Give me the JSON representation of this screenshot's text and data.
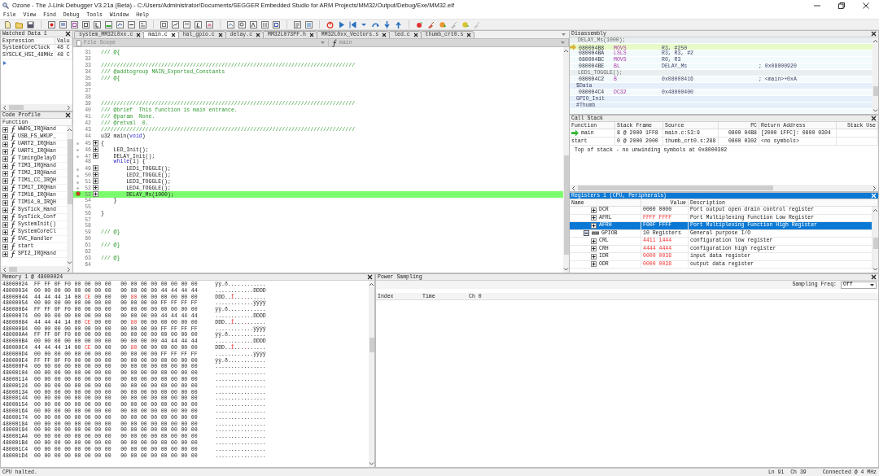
{
  "window": {
    "title": "Ozone - The J-Link Debugger V3.21a (Beta) - C:/Users/Administrator/Documents/SEGGER Embedded Studio for ARM Projects/MM32/Output/Debug/Exe/MM32.elf"
  },
  "menu": [
    "File",
    "View",
    "Find",
    "Debug",
    "Tools",
    "Window",
    "Help"
  ],
  "watched_data": {
    "title": "Watched Data 1",
    "columns": [
      "Expression",
      "Valu"
    ],
    "rows": [
      {
        "expression": "SystemCoreClock",
        "value": "48 C"
      },
      {
        "expression": "SYSCLK_HSI_48MHz",
        "value": "48 C"
      }
    ]
  },
  "code_profile": {
    "title": "Code Profile",
    "columns": [
      "Function"
    ],
    "rows": [
      "WWDG_IRQHand",
      "USB_FS_WKUP_",
      "UART2_IRQHan",
      "UART1_IRQHan",
      "TimingDelayD",
      "TIM3_IRQHand",
      "TIM2_IRQHand",
      "TIM1_CC_IRQH",
      "TIM17_IRQHan",
      "TIM16_IRQHan",
      "TIM14_0_IRQH",
      "SysTick_Hand",
      "SysTick_Conf",
      "SystemInit()",
      "SystemCoreCl",
      "SVC_Handler",
      "start",
      "SPI2_IRQHand"
    ]
  },
  "editor": {
    "tabs": [
      {
        "label": "system_MM32L0xx.c",
        "selected": false
      },
      {
        "label": "main.c",
        "selected": true
      },
      {
        "label": "hal_gpio.c",
        "selected": false
      },
      {
        "label": "delay.c",
        "selected": false
      },
      {
        "label": "MM32L073PF.h",
        "selected": false
      },
      {
        "label": "MM32L0xx_Vectors.s",
        "selected": false
      },
      {
        "label": "led.c",
        "selected": false
      },
      {
        "label": "thumb_crt0.s",
        "selected": false
      }
    ],
    "scope": "File Scope",
    "function": "main",
    "lines": [
      {
        "number": "31",
        "parts": [
          {
            "text": "/// @{",
            "kind": "comment"
          }
        ],
        "breakable": false,
        "breakpoint": false,
        "current": false
      },
      {
        "number": "32",
        "breakable": false,
        "breakpoint": false,
        "current": false
      },
      {
        "number": "33",
        "parts": [
          {
            "text": "////////////////////////////////////////////////////////////////////////////////",
            "kind": "comment"
          }
        ],
        "breakable": false,
        "breakpoint": false,
        "current": false
      },
      {
        "number": "34",
        "parts": [
          {
            "text": "/// @addtogroup MAIN_Exported_Constants",
            "kind": "comment"
          }
        ],
        "breakable": false,
        "breakpoint": false,
        "current": false
      },
      {
        "number": "35",
        "parts": [
          {
            "text": "/// @{",
            "kind": "comment"
          }
        ],
        "breakable": false,
        "breakpoint": false,
        "current": false
      },
      {
        "number": "36",
        "breakable": false,
        "breakpoint": false,
        "current": false
      },
      {
        "number": "37",
        "breakable": false,
        "breakpoint": false,
        "current": false
      },
      {
        "number": "38",
        "breakable": false,
        "breakpoint": false,
        "current": false
      },
      {
        "number": "39",
        "parts": [
          {
            "text": "////////////////////////////////////////////////////////////////////////////////",
            "kind": "comment"
          }
        ],
        "breakable": false,
        "breakpoint": false,
        "current": false
      },
      {
        "number": "40",
        "parts": [
          {
            "text": "/// @brief  This function is main entrance.",
            "kind": "comment"
          }
        ],
        "breakable": false,
        "breakpoint": false,
        "current": false
      },
      {
        "number": "41",
        "parts": [
          {
            "text": "/// @param  None.",
            "kind": "comment"
          }
        ],
        "breakable": false,
        "breakpoint": false,
        "current": false
      },
      {
        "number": "42",
        "parts": [
          {
            "text": "/// @retval  0.",
            "kind": "comment"
          }
        ],
        "breakable": false,
        "breakpoint": false,
        "current": false
      },
      {
        "number": "43",
        "parts": [
          {
            "text": "////////////////////////////////////////////////////////////////////////////////",
            "kind": "comment"
          }
        ],
        "breakable": false,
        "breakpoint": false,
        "current": false
      },
      {
        "number": "44",
        "parts": [
          {
            "text": "u32 main(",
            "kind": "code"
          },
          {
            "text": "void",
            "kind": "keyword"
          },
          {
            "text": ")",
            "kind": "code"
          }
        ],
        "breakable": false,
        "breakpoint": false,
        "current": false
      },
      {
        "number": "45",
        "parts": [
          {
            "text": "{",
            "kind": "code"
          }
        ],
        "breakable": true,
        "breakpoint": false,
        "current": false
      },
      {
        "number": "46",
        "parts": [
          {
            "text": "    LED_Init();",
            "kind": "code"
          }
        ],
        "breakable": true,
        "breakpoint": false,
        "current": false
      },
      {
        "number": "47",
        "parts": [
          {
            "text": "    DELAY_Init();",
            "kind": "code"
          }
        ],
        "breakable": true,
        "breakpoint": false,
        "current": false
      },
      {
        "number": "48",
        "parts": [
          {
            "text": "    while",
            "kind": "keyword"
          },
          {
            "text": "(1) {",
            "kind": "code"
          }
        ],
        "breakable": false,
        "breakpoint": false,
        "current": false
      },
      {
        "number": "49",
        "parts": [
          {
            "text": "        LED1_TOGGLE();",
            "kind": "code"
          }
        ],
        "breakable": true,
        "breakpoint": false,
        "current": false
      },
      {
        "number": "50",
        "parts": [
          {
            "text": "        LED2_TOGGLE();",
            "kind": "code"
          }
        ],
        "breakable": true,
        "breakpoint": false,
        "current": false
      },
      {
        "number": "51",
        "parts": [
          {
            "text": "        LED3_TOGGLE();",
            "kind": "code"
          }
        ],
        "breakable": true,
        "breakpoint": false,
        "current": false
      },
      {
        "number": "52",
        "parts": [
          {
            "text": "        LED4_TOGGLE();",
            "kind": "code"
          }
        ],
        "breakable": true,
        "breakpoint": false,
        "current": false
      },
      {
        "number": "53",
        "parts": [
          {
            "text": "        DELAY_Ms(1000);",
            "kind": "code"
          }
        ],
        "breakable": true,
        "breakpoint": true,
        "current": true
      },
      {
        "number": "54",
        "parts": [
          {
            "text": "    }",
            "kind": "code"
          }
        ],
        "breakable": false,
        "breakpoint": false,
        "current": false
      },
      {
        "number": "55",
        "breakable": false,
        "breakpoint": false,
        "current": false
      },
      {
        "number": "56",
        "parts": [
          {
            "text": "}",
            "kind": "code"
          }
        ],
        "breakable": false,
        "breakpoint": false,
        "current": false
      },
      {
        "number": "57",
        "breakable": false,
        "breakpoint": false,
        "current": false
      },
      {
        "number": "58",
        "breakable": false,
        "breakpoint": false,
        "current": false
      },
      {
        "number": "59",
        "parts": [
          {
            "text": "/// @}",
            "kind": "comment"
          }
        ],
        "breakable": false,
        "breakpoint": false,
        "current": false
      },
      {
        "number": "60",
        "breakable": false,
        "breakpoint": false,
        "current": false
      },
      {
        "number": "61",
        "parts": [
          {
            "text": "/// @}",
            "kind": "comment"
          }
        ],
        "breakable": false,
        "breakpoint": false,
        "current": false
      },
      {
        "number": "62",
        "breakable": false,
        "breakpoint": false,
        "current": false
      },
      {
        "number": "63",
        "parts": [
          {
            "text": "/// @}",
            "kind": "comment"
          }
        ],
        "breakable": false,
        "breakpoint": false,
        "current": false
      },
      {
        "number": "64",
        "breakable": false,
        "breakpoint": false,
        "current": false
      }
    ]
  },
  "disassembly": {
    "title": "Disassembly",
    "rows": [
      {
        "kind": "source",
        "text": "DELAY_Ms(1000);",
        "current": false
      },
      {
        "kind": "instruction",
        "address": "080004B8",
        "mnemonic": "MOVS",
        "operands": "R3, #250",
        "current": true
      },
      {
        "kind": "instruction",
        "address": "080004BA",
        "mnemonic": "LSLS",
        "operands": "R3, R3, #2",
        "current": false
      },
      {
        "kind": "instruction",
        "address": "080004BC",
        "mnemonic": "MOVS",
        "operands": "R0, R3",
        "current": false
      },
      {
        "kind": "instruction",
        "address": "080004BE",
        "mnemonic": "BL",
        "operands": "DELAY_Ms",
        "comment": "; 0x08000920",
        "current": false
      },
      {
        "kind": "source",
        "text": "LED1_TOGGLE();",
        "current": false
      },
      {
        "kind": "instruction",
        "address": "080004C2",
        "mnemonic": "B",
        "operands": "0x08000416",
        "comment": "; <main>+0xA",
        "current": false
      },
      {
        "kind": "label",
        "text": "$Data",
        "current": false
      },
      {
        "kind": "instruction",
        "address": "080004C4",
        "mnemonic": "DC32",
        "operands": "0x48000400",
        "current": false
      },
      {
        "kind": "label",
        "text": "GPIO_Init",
        "current": false
      },
      {
        "kind": "label",
        "text": "#Thumb",
        "current": false
      }
    ]
  },
  "call_stack": {
    "title": "Call Stack",
    "columns": [
      "Function",
      "Stack Frame",
      "Source",
      "PC",
      "Return Address",
      "Stack Use"
    ],
    "rows": [
      {
        "function": "main",
        "frame": "8 @ 2000 1FF8",
        "source": "main.c:53:9",
        "pc": "0800 04B8",
        "return_address": "[2000 1FFC]: 0800 0304",
        "current": true
      },
      {
        "function": "start",
        "frame": "0 @ 2000 2000",
        "source": "thumb_crt0.s:288",
        "pc": "0800 0302",
        "return_address": "<no symbols>",
        "current": false
      }
    ],
    "note": "Top of stack - no unwinding symbols at 0x8000302"
  },
  "registers": {
    "title": "Registers 1 (CPU, Peripherals)",
    "active": true,
    "columns": [
      "Name",
      "Value",
      "Description"
    ],
    "rows": [
      {
        "kind": "register",
        "name": "DCR",
        "value": "0000 0000",
        "description": "Port output open drain control register",
        "changed": false,
        "selected": false,
        "expanded": false
      },
      {
        "kind": "register",
        "name": "AFRL",
        "value": "FFFF FFFF",
        "description": "Port Multiplexing Function Low Register",
        "changed": true,
        "selected": false,
        "expanded": false
      },
      {
        "kind": "register",
        "name": "AFRH",
        "value": "F00F FFFF",
        "description": "Port Multiplexing Function High Register",
        "changed": false,
        "selected": true,
        "expanded": false
      },
      {
        "kind": "group",
        "name": "GPIOB",
        "value": "10 Registers",
        "description": "General purpose I/O",
        "changed": false,
        "selected": false,
        "expanded": true,
        "children": [
          {
            "kind": "register",
            "name": "CRL",
            "value": "4411 1444",
            "description": "configuration low register",
            "changed": true,
            "selected": false,
            "expanded": false
          },
          {
            "kind": "register",
            "name": "CRH",
            "value": "4444 4444",
            "description": "configuration high register",
            "changed": true,
            "selected": false,
            "expanded": false
          },
          {
            "kind": "register",
            "name": "IDR",
            "value": "0000 0038",
            "description": "input data register",
            "changed": true,
            "selected": false,
            "expanded": false
          },
          {
            "kind": "register",
            "name": "ODR",
            "value": "0000 0038",
            "description": "output data register",
            "changed": true,
            "selected": false,
            "expanded": false
          }
        ]
      }
    ]
  },
  "memory": {
    "title": "Memory 1 @ 48000024",
    "rows": [
      {
        "address": "48000024",
        "bytes": [
          "FF",
          "FF",
          "0F",
          "F0",
          "00",
          "00",
          "00",
          "00",
          "00",
          "00",
          "00",
          "00",
          "00",
          "00",
          "00",
          "00"
        ],
        "changed": [
          false,
          false,
          false,
          false,
          false,
          false,
          false,
          false,
          false,
          false,
          false,
          false,
          false,
          false,
          false,
          false
        ],
        "ascii": "ÿÿ.ð............"
      },
      {
        "address": "48000034",
        "bytes": [
          "00",
          "00",
          "00",
          "00",
          "00",
          "00",
          "00",
          "00",
          "00",
          "00",
          "00",
          "00",
          "44",
          "44",
          "44",
          "44"
        ],
        "changed": [
          false,
          false,
          false,
          false,
          false,
          false,
          false,
          false,
          false,
          false,
          false,
          false,
          false,
          false,
          false,
          false
        ],
        "ascii": "............DDDD"
      },
      {
        "address": "48000044",
        "bytes": [
          "44",
          "44",
          "44",
          "14",
          "00",
          "CE",
          "00",
          "00",
          "00",
          "80",
          "00",
          "00",
          "00",
          "00",
          "00",
          "00"
        ],
        "changed": [
          false,
          false,
          false,
          false,
          false,
          true,
          false,
          false,
          false,
          true,
          false,
          false,
          false,
          false,
          false,
          false
        ],
        "ascii": "DDD..Î.........."
      },
      {
        "address": "48000054",
        "bytes": [
          "00",
          "00",
          "00",
          "00",
          "00",
          "00",
          "00",
          "00",
          "00",
          "00",
          "00",
          "00",
          "FF",
          "FF",
          "FF",
          "FF"
        ],
        "changed": [
          false,
          false,
          false,
          false,
          false,
          false,
          false,
          false,
          false,
          false,
          false,
          false,
          false,
          false,
          false,
          false
        ],
        "ascii": "............ÿÿÿÿ"
      },
      {
        "address": "48000064",
        "bytes": [
          "FF",
          "FF",
          "0F",
          "F0",
          "00",
          "00",
          "00",
          "00",
          "00",
          "00",
          "00",
          "00",
          "00",
          "00",
          "00",
          "00"
        ],
        "changed": [
          false,
          false,
          false,
          false,
          false,
          false,
          false,
          false,
          false,
          false,
          false,
          false,
          false,
          false,
          false,
          false
        ],
        "ascii": "ÿÿ.ð............"
      },
      {
        "address": "48000074",
        "bytes": [
          "00",
          "00",
          "00",
          "00",
          "00",
          "00",
          "00",
          "00",
          "00",
          "00",
          "00",
          "00",
          "44",
          "44",
          "44",
          "44"
        ],
        "changed": [
          false,
          false,
          false,
          false,
          false,
          false,
          false,
          false,
          false,
          false,
          false,
          false,
          false,
          false,
          false,
          false
        ],
        "ascii": "............DDDD"
      },
      {
        "address": "48000084",
        "bytes": [
          "44",
          "44",
          "44",
          "14",
          "00",
          "CE",
          "00",
          "00",
          "00",
          "80",
          "00",
          "00",
          "00",
          "00",
          "00",
          "00"
        ],
        "changed": [
          false,
          false,
          false,
          false,
          false,
          true,
          false,
          false,
          false,
          true,
          false,
          false,
          false,
          false,
          false,
          false
        ],
        "ascii": "DDD..Î.........."
      },
      {
        "address": "48000094",
        "bytes": [
          "00",
          "00",
          "00",
          "00",
          "00",
          "00",
          "00",
          "00",
          "00",
          "00",
          "00",
          "00",
          "FF",
          "FF",
          "FF",
          "FF"
        ],
        "changed": [
          false,
          false,
          false,
          false,
          false,
          false,
          false,
          false,
          false,
          false,
          false,
          false,
          false,
          false,
          false,
          false
        ],
        "ascii": "............ÿÿÿÿ"
      },
      {
        "address": "480000A4",
        "bytes": [
          "FF",
          "FF",
          "0F",
          "F0",
          "00",
          "00",
          "00",
          "00",
          "00",
          "00",
          "00",
          "00",
          "00",
          "00",
          "00",
          "00"
        ],
        "changed": [
          false,
          false,
          false,
          false,
          false,
          false,
          false,
          false,
          false,
          false,
          false,
          false,
          false,
          false,
          false,
          false
        ],
        "ascii": "ÿÿ.ð............"
      },
      {
        "address": "480000B4",
        "bytes": [
          "00",
          "00",
          "00",
          "00",
          "00",
          "00",
          "00",
          "00",
          "00",
          "00",
          "00",
          "00",
          "44",
          "44",
          "44",
          "44"
        ],
        "changed": [
          false,
          false,
          false,
          false,
          false,
          false,
          false,
          false,
          false,
          false,
          false,
          false,
          false,
          false,
          false,
          false
        ],
        "ascii": "............DDDD"
      },
      {
        "address": "480000C4",
        "bytes": [
          "44",
          "44",
          "44",
          "14",
          "00",
          "CE",
          "00",
          "00",
          "00",
          "80",
          "00",
          "00",
          "00",
          "00",
          "00",
          "00"
        ],
        "changed": [
          false,
          false,
          false,
          false,
          false,
          true,
          false,
          false,
          false,
          true,
          false,
          false,
          false,
          false,
          false,
          false
        ],
        "ascii": "DDD..Î.........."
      },
      {
        "address": "480000D4",
        "bytes": [
          "00",
          "00",
          "00",
          "00",
          "00",
          "00",
          "00",
          "00",
          "00",
          "00",
          "00",
          "00",
          "FF",
          "FF",
          "FF",
          "FF"
        ],
        "changed": [
          false,
          false,
          false,
          false,
          false,
          false,
          false,
          false,
          false,
          false,
          false,
          false,
          false,
          false,
          false,
          false
        ],
        "ascii": "............ÿÿÿÿ"
      },
      {
        "address": "480000E4",
        "bytes": [
          "FF",
          "FF",
          "0F",
          "F0",
          "00",
          "00",
          "00",
          "00",
          "00",
          "00",
          "00",
          "00",
          "00",
          "00",
          "00",
          "00"
        ],
        "changed": [
          false,
          false,
          false,
          false,
          false,
          false,
          false,
          false,
          false,
          false,
          false,
          false,
          false,
          false,
          false,
          false
        ],
        "ascii": "ÿÿ.ð............"
      },
      {
        "address": "480000F4",
        "bytes": [
          "00",
          "00",
          "00",
          "00",
          "00",
          "00",
          "00",
          "00",
          "00",
          "00",
          "00",
          "00",
          "00",
          "00",
          "00",
          "00"
        ],
        "changed": [
          false,
          false,
          false,
          false,
          false,
          false,
          false,
          false,
          false,
          false,
          false,
          false,
          false,
          false,
          false,
          false
        ],
        "ascii": "................"
      },
      {
        "address": "48000104",
        "bytes": [
          "00",
          "00",
          "00",
          "00",
          "00",
          "00",
          "00",
          "00",
          "00",
          "00",
          "00",
          "00",
          "00",
          "00",
          "00",
          "00"
        ],
        "changed": [
          false,
          false,
          false,
          false,
          false,
          false,
          false,
          false,
          false,
          false,
          false,
          false,
          false,
          false,
          false,
          false
        ],
        "ascii": "................"
      },
      {
        "address": "48000114",
        "bytes": [
          "00",
          "00",
          "00",
          "00",
          "00",
          "00",
          "00",
          "00",
          "00",
          "00",
          "00",
          "00",
          "00",
          "00",
          "00",
          "00"
        ],
        "changed": [
          false,
          false,
          false,
          false,
          false,
          false,
          false,
          false,
          false,
          false,
          false,
          false,
          false,
          false,
          false,
          false
        ],
        "ascii": "................"
      },
      {
        "address": "48000124",
        "bytes": [
          "00",
          "00",
          "00",
          "00",
          "00",
          "00",
          "00",
          "00",
          "00",
          "00",
          "00",
          "00",
          "00",
          "00",
          "00",
          "00"
        ],
        "changed": [
          false,
          false,
          false,
          false,
          false,
          false,
          false,
          false,
          false,
          false,
          false,
          false,
          false,
          false,
          false,
          false
        ],
        "ascii": "................"
      },
      {
        "address": "48000134",
        "bytes": [
          "00",
          "00",
          "00",
          "00",
          "00",
          "00",
          "00",
          "00",
          "00",
          "00",
          "00",
          "00",
          "00",
          "00",
          "00",
          "00"
        ],
        "changed": [
          false,
          false,
          false,
          false,
          false,
          false,
          false,
          false,
          false,
          false,
          false,
          false,
          false,
          false,
          false,
          false
        ],
        "ascii": "................"
      },
      {
        "address": "48000144",
        "bytes": [
          "00",
          "00",
          "00",
          "00",
          "00",
          "00",
          "00",
          "00",
          "00",
          "00",
          "00",
          "00",
          "00",
          "00",
          "00",
          "00"
        ],
        "changed": [
          false,
          false,
          false,
          false,
          false,
          false,
          false,
          false,
          false,
          false,
          false,
          false,
          false,
          false,
          false,
          false
        ],
        "ascii": "................"
      },
      {
        "address": "48000154",
        "bytes": [
          "00",
          "00",
          "00",
          "00",
          "00",
          "00",
          "00",
          "00",
          "00",
          "00",
          "00",
          "00",
          "00",
          "00",
          "00",
          "00"
        ],
        "changed": [
          false,
          false,
          false,
          false,
          false,
          false,
          false,
          false,
          false,
          false,
          false,
          false,
          false,
          false,
          false,
          false
        ],
        "ascii": "................"
      },
      {
        "address": "48000164",
        "bytes": [
          "00",
          "00",
          "00",
          "00",
          "00",
          "00",
          "00",
          "00",
          "00",
          "00",
          "00",
          "00",
          "00",
          "00",
          "00",
          "00"
        ],
        "changed": [
          false,
          false,
          false,
          false,
          false,
          false,
          false,
          false,
          false,
          false,
          false,
          false,
          false,
          false,
          false,
          false
        ],
        "ascii": "................"
      },
      {
        "address": "48000174",
        "bytes": [
          "00",
          "00",
          "00",
          "00",
          "00",
          "00",
          "00",
          "00",
          "00",
          "00",
          "00",
          "00",
          "00",
          "00",
          "00",
          "00"
        ],
        "changed": [
          false,
          false,
          false,
          false,
          false,
          false,
          false,
          false,
          false,
          false,
          false,
          false,
          false,
          false,
          false,
          false
        ],
        "ascii": "................"
      },
      {
        "address": "48000184",
        "bytes": [
          "00",
          "00",
          "00",
          "00",
          "00",
          "00",
          "00",
          "00",
          "00",
          "00",
          "00",
          "00",
          "00",
          "00",
          "00",
          "00"
        ],
        "changed": [
          false,
          false,
          false,
          false,
          false,
          false,
          false,
          false,
          false,
          false,
          false,
          false,
          false,
          false,
          false,
          false
        ],
        "ascii": "................"
      },
      {
        "address": "48000194",
        "bytes": [
          "00",
          "00",
          "00",
          "00",
          "00",
          "00",
          "00",
          "00",
          "00",
          "00",
          "00",
          "00",
          "00",
          "00",
          "00",
          "00"
        ],
        "changed": [
          false,
          false,
          false,
          false,
          false,
          false,
          false,
          false,
          false,
          false,
          false,
          false,
          false,
          false,
          false,
          false
        ],
        "ascii": "................"
      },
      {
        "address": "480001A4",
        "bytes": [
          "00",
          "00",
          "00",
          "00",
          "00",
          "00",
          "00",
          "00",
          "00",
          "00",
          "00",
          "00",
          "00",
          "00",
          "00",
          "00"
        ],
        "changed": [
          false,
          false,
          false,
          false,
          false,
          false,
          false,
          false,
          false,
          false,
          false,
          false,
          false,
          false,
          false,
          false
        ],
        "ascii": "................"
      },
      {
        "address": "480001B4",
        "bytes": [
          "00",
          "00",
          "00",
          "00",
          "00",
          "00",
          "00",
          "00",
          "00",
          "00",
          "00",
          "00",
          "00",
          "00",
          "00",
          "00"
        ],
        "changed": [
          false,
          false,
          false,
          false,
          false,
          false,
          false,
          false,
          false,
          false,
          false,
          false,
          false,
          false,
          false,
          false
        ],
        "ascii": "................"
      },
      {
        "address": "480001C4",
        "bytes": [
          "00",
          "00",
          "00",
          "00",
          "00",
          "00",
          "00",
          "00",
          "00",
          "00",
          "00",
          "00",
          "00",
          "00",
          "00",
          "00"
        ],
        "changed": [
          false,
          false,
          false,
          false,
          false,
          false,
          false,
          false,
          false,
          false,
          false,
          false,
          false,
          false,
          false,
          false
        ],
        "ascii": "................"
      },
      {
        "address": "480001D4",
        "bytes": [
          "00",
          "00",
          "00",
          "00",
          "00",
          "00",
          "00",
          "00",
          "00",
          "00",
          "00",
          "00",
          "00",
          "00",
          "00",
          "00"
        ],
        "changed": [
          false,
          false,
          false,
          false,
          false,
          false,
          false,
          false,
          false,
          false,
          false,
          false,
          false,
          false,
          false,
          false
        ],
        "ascii": "................"
      }
    ]
  },
  "power_sampling": {
    "title": "Power Sampling",
    "freq_label": "Sampling Freq:",
    "freq": "Off",
    "columns": [
      "Index",
      "Time",
      "Ch 0"
    ]
  },
  "status_bar": {
    "message": "CPU halted.",
    "position": "Ln 91  Ch 39",
    "connection": "Connected @ 4 MHz"
  }
}
